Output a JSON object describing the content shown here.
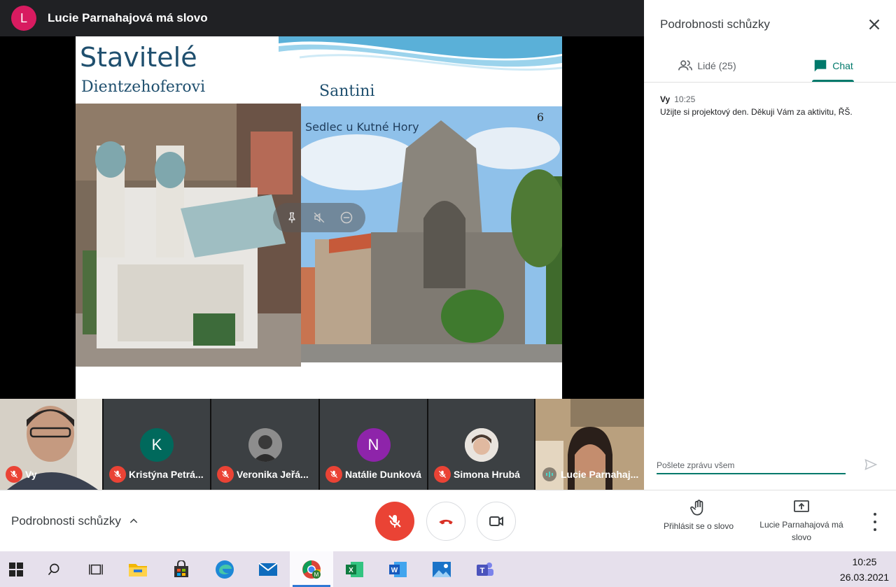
{
  "presenter_bar": {
    "avatar_letter": "L",
    "text": "Lucie Parnahajová má slovo"
  },
  "slide": {
    "title": "Stavitelé",
    "subtitle": "Dientzehoferovi",
    "right_heading": "Santini",
    "photo_caption": "Sedlec u Kutné Hory",
    "number": "6"
  },
  "participants": [
    {
      "name": "Vy",
      "type": "video",
      "mic": "off"
    },
    {
      "name": "Kristýna Petrá...",
      "type": "avatar",
      "letter": "K",
      "color": "#00695c",
      "mic": "off"
    },
    {
      "name": "Veronika Jeřá...",
      "type": "photo",
      "mic": "off"
    },
    {
      "name": "Natálie Dunková",
      "type": "avatar",
      "letter": "N",
      "color": "#8e24aa",
      "mic": "off"
    },
    {
      "name": "Simona Hrubá",
      "type": "photo",
      "mic": "off"
    },
    {
      "name": "Lucie Parnahaj...",
      "type": "video",
      "mic": "speaking"
    }
  ],
  "panel": {
    "title": "Podrobnosti schůzky",
    "tabs": [
      {
        "label": "Lidé (25)",
        "icon": "people-icon",
        "active": false
      },
      {
        "label": "Chat",
        "icon": "chat-icon",
        "active": true
      }
    ],
    "message": {
      "sender": "Vy",
      "time": "10:25",
      "text": "Užijte si projektový den. Děkuji Vám za aktivitu, ŘŠ."
    },
    "compose_placeholder": "Pošlete zprávu všem"
  },
  "controls": {
    "details_label": "Podrobnosti schůzky",
    "raise_hand_label": "Přihlásit se o slovo",
    "present_label": "Lucie Parnahajová má slovo"
  },
  "taskbar": {
    "apps": [
      "start-icon",
      "search-icon",
      "task-view-icon",
      "file-explorer-icon",
      "store-icon",
      "edge-icon",
      "mail-icon",
      "chrome-icon",
      "excel-icon",
      "word-icon",
      "photos-icon",
      "teams-icon"
    ],
    "active_app": "chrome-icon",
    "time": "10:25",
    "date": "26.03.2021"
  },
  "colors": {
    "accent": "#00796b",
    "mic_off": "#ea4335",
    "presenter_avatar": "#d81b60"
  }
}
